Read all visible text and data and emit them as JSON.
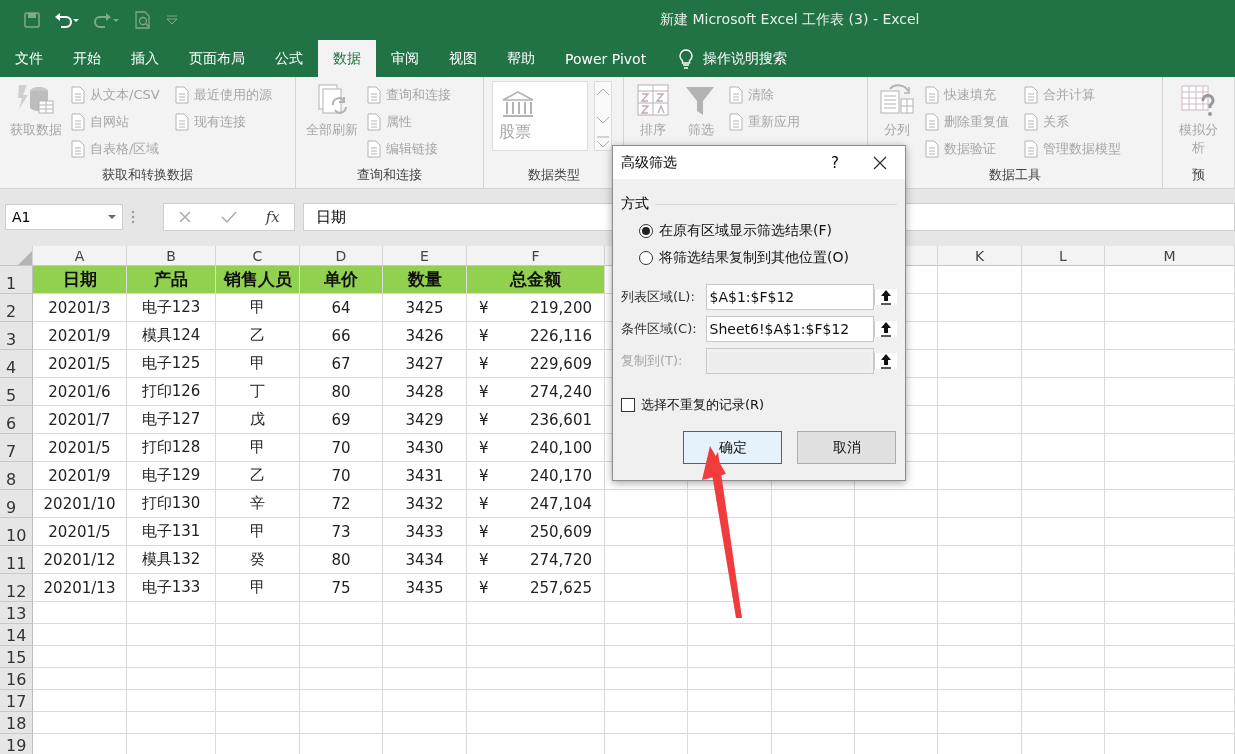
{
  "window": {
    "title": "新建 Microsoft Excel 工作表 (3)  -  Excel"
  },
  "tabs": [
    {
      "label": "文件",
      "selected": false
    },
    {
      "label": "开始",
      "selected": false
    },
    {
      "label": "插入",
      "selected": false
    },
    {
      "label": "页面布局",
      "selected": false
    },
    {
      "label": "公式",
      "selected": false
    },
    {
      "label": "数据",
      "selected": true
    },
    {
      "label": "审阅",
      "selected": false
    },
    {
      "label": "视图",
      "selected": false
    },
    {
      "label": "帮助",
      "selected": false
    },
    {
      "label": "Power Pivot",
      "selected": false
    }
  ],
  "tell_me": {
    "placeholder": "操作说明搜索"
  },
  "ribbon": {
    "groups": [
      {
        "label": "获取和转换数据",
        "large": [
          {
            "label": "获取数据",
            "disabled": true
          }
        ],
        "small": [
          {
            "label": "从文本/CSV",
            "disabled": true
          },
          {
            "label": "自网站",
            "disabled": true
          },
          {
            "label": "自表格/区域",
            "disabled": true
          },
          {
            "label": "最近使用的源",
            "disabled": true
          },
          {
            "label": "现有连接",
            "disabled": true
          }
        ]
      },
      {
        "label": "查询和连接",
        "large": [
          {
            "label": "全部刷新",
            "disabled": true
          }
        ],
        "small": [
          {
            "label": "查询和连接",
            "disabled": true
          },
          {
            "label": "属性",
            "disabled": true
          },
          {
            "label": "编辑链接",
            "disabled": true
          }
        ]
      },
      {
        "label": "数据类型",
        "large": [
          {
            "label": "股票",
            "disabled": true
          }
        ]
      },
      {
        "large": [
          {
            "label": "排序",
            "disabled": true
          },
          {
            "label": "筛选",
            "disabled": true
          }
        ],
        "small": [
          {
            "label": "清除",
            "disabled": true
          },
          {
            "label": "重新应用",
            "disabled": true
          }
        ]
      },
      {
        "label": "数据工具",
        "large": [
          {
            "label": "分列",
            "disabled": true
          }
        ],
        "small": [
          {
            "label": "快速填充",
            "disabled": true
          },
          {
            "label": "删除重复值",
            "disabled": true
          },
          {
            "label": "数据验证",
            "disabled": true
          },
          {
            "label": "合并计算",
            "disabled": true
          },
          {
            "label": "关系",
            "disabled": true
          },
          {
            "label": "管理数据模型",
            "disabled": true
          }
        ]
      },
      {
        "label": "预",
        "large": [
          {
            "label": "模拟分析",
            "disabled": true
          }
        ]
      }
    ]
  },
  "formula_bar": {
    "name_box": "A1",
    "fx": "fx",
    "value": "日期"
  },
  "sheet": {
    "columns": [
      "A",
      "B",
      "C",
      "D",
      "E",
      "F"
    ],
    "far_columns": [
      "K",
      "L",
      "M"
    ],
    "header": {
      "number": "1",
      "cells": [
        "日期",
        "产品",
        "销售人员",
        "单价",
        "数量",
        "总金额"
      ]
    },
    "rows": [
      {
        "number": "2",
        "cells": [
          "20201/3",
          "电子123",
          "甲",
          "64",
          "3425",
          "219,200"
        ],
        "currency": "¥"
      },
      {
        "number": "3",
        "cells": [
          "20201/9",
          "模具124",
          "乙",
          "66",
          "3426",
          "226,116"
        ],
        "currency": "¥"
      },
      {
        "number": "4",
        "cells": [
          "20201/5",
          "电子125",
          "甲",
          "67",
          "3427",
          "229,609"
        ],
        "currency": "¥"
      },
      {
        "number": "5",
        "cells": [
          "20201/6",
          "打印126",
          "丁",
          "80",
          "3428",
          "274,240"
        ],
        "currency": "¥"
      },
      {
        "number": "6",
        "cells": [
          "20201/7",
          "电子127",
          "戊",
          "69",
          "3429",
          "236,601"
        ],
        "currency": "¥"
      },
      {
        "number": "7",
        "cells": [
          "20201/5",
          "打印128",
          "甲",
          "70",
          "3430",
          "240,100"
        ],
        "currency": "¥"
      },
      {
        "number": "8",
        "cells": [
          "20201/9",
          "电子129",
          "乙",
          "70",
          "3431",
          "240,170"
        ],
        "currency": "¥"
      },
      {
        "number": "9",
        "cells": [
          "20201/10",
          "打印130",
          "辛",
          "72",
          "3432",
          "247,104"
        ],
        "currency": "¥"
      },
      {
        "number": "10",
        "cells": [
          "20201/5",
          "电子131",
          "甲",
          "73",
          "3433",
          "250,609"
        ],
        "currency": "¥"
      },
      {
        "number": "11",
        "cells": [
          "20201/12",
          "模具132",
          "癸",
          "80",
          "3434",
          "274,720"
        ],
        "currency": "¥"
      },
      {
        "number": "12",
        "cells": [
          "20201/13",
          "电子133",
          "甲",
          "75",
          "3435",
          "257,625"
        ],
        "currency": "¥"
      }
    ],
    "empty_rows": [
      "13",
      "14",
      "15",
      "16",
      "17",
      "18",
      "19"
    ]
  },
  "dialog": {
    "title": "高级筛选",
    "help": "?",
    "section": "方式",
    "options": [
      {
        "label": "在原有区域显示筛选结果(F)",
        "selected": true
      },
      {
        "label": "将筛选结果复制到其他位置(O)",
        "selected": false
      }
    ],
    "fields": [
      {
        "label": "列表区域(L):",
        "value": "$A$1:$F$12",
        "disabled": false
      },
      {
        "label": "条件区域(C):",
        "value": "Sheet6!$A$1:$F$12",
        "disabled": false
      },
      {
        "label": "复制到(T):",
        "disabled": true
      }
    ],
    "checkbox": {
      "label": "选择不重复的记录(R)",
      "checked": false
    },
    "buttons": [
      {
        "label": "确定",
        "default": true
      },
      {
        "label": "取消",
        "default": false
      }
    ]
  }
}
